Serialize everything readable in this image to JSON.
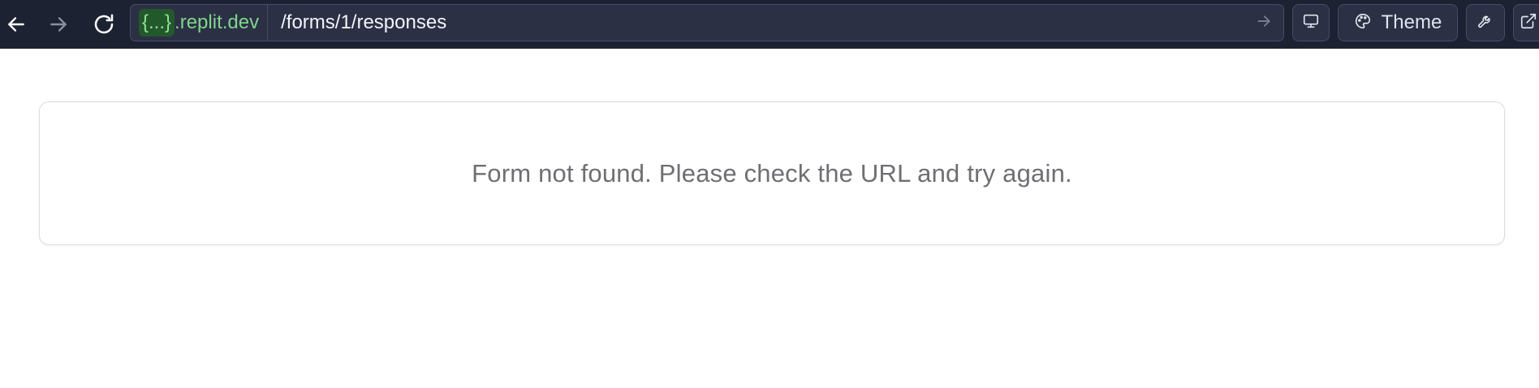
{
  "browser": {
    "back_icon": "arrow-left-icon",
    "forward_icon": "arrow-right-icon",
    "reload_icon": "reload-icon",
    "url": {
      "host_badge": "{...}",
      "host_domain": ".replit.dev",
      "path": "/forms/1/responses",
      "go_icon": "arrow-right-icon"
    },
    "tools": {
      "devices_icon": "monitor-icon",
      "theme_icon": "palette-icon",
      "theme_label": "Theme",
      "devtools_icon": "wrench-icon",
      "open_external_icon": "external-link-icon"
    },
    "colors": {
      "toolbar_bg": "#1d2233",
      "host_badge_bg": "#23582b",
      "host_text": "#7fd68a"
    }
  },
  "page": {
    "error_message": "Form not found. Please check the URL and try again."
  }
}
